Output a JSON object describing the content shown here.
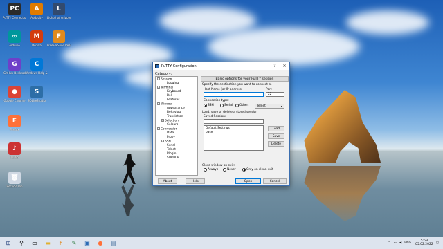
{
  "desktop": {
    "icons": [
      {
        "label": "PuTTY\nConnectio..",
        "color": "#2b2b2b",
        "glyph": "PC"
      },
      {
        "label": "Audacity",
        "color": "#e07b00",
        "glyph": "A"
      },
      {
        "label": "Lightshot\nsnipper",
        "color": "#324a6e",
        "glyph": "L"
      },
      {
        "label": "Arduino",
        "color": "#00979c",
        "glyph": "∞"
      },
      {
        "label": "Mozilla",
        "color": "#d33c0e",
        "glyph": "M"
      },
      {
        "label": "FreeFileSync\nRealtime",
        "color": "#e08a1e",
        "glyph": "F"
      },
      {
        "label": "GitHub\nDesktop",
        "color": "#6e40c9",
        "glyph": "G"
      },
      {
        "label": "Windows\nHelp & Tips",
        "color": "#0078d7",
        "glyph": "C"
      },
      {
        "label": "Google\nChrome",
        "color": "#db4437",
        "glyph": "●"
      },
      {
        "label": "SQLiteStudio",
        "color": "#2d6ea7",
        "glyph": "S"
      },
      {
        "label": "Firefox",
        "color": "#ff7139",
        "glyph": "F"
      },
      {
        "label": "Audio",
        "color": "#cc3333",
        "glyph": "♪"
      },
      {
        "label": "Recycle Bin",
        "color": "#cfd8e3",
        "glyph": "🗑"
      }
    ]
  },
  "putty": {
    "title": "PuTTY Configuration",
    "help_btn": "?",
    "close_btn": "×",
    "category_label": "Category:",
    "tree": [
      {
        "label": "Session",
        "level": 0,
        "exp": "-"
      },
      {
        "label": "Logging",
        "level": 2,
        "exp": ""
      },
      {
        "label": "Terminal",
        "level": 0,
        "exp": "-"
      },
      {
        "label": "Keyboard",
        "level": 2,
        "exp": ""
      },
      {
        "label": "Bell",
        "level": 2,
        "exp": ""
      },
      {
        "label": "Features",
        "level": 2,
        "exp": ""
      },
      {
        "label": "Window",
        "level": 0,
        "exp": "-"
      },
      {
        "label": "Appearance",
        "level": 2,
        "exp": ""
      },
      {
        "label": "Behaviour",
        "level": 2,
        "exp": ""
      },
      {
        "label": "Translation",
        "level": 2,
        "exp": ""
      },
      {
        "label": "Selection",
        "level": 1,
        "exp": "+"
      },
      {
        "label": "Colours",
        "level": 2,
        "exp": ""
      },
      {
        "label": "Connection",
        "level": 0,
        "exp": "-"
      },
      {
        "label": "Data",
        "level": 2,
        "exp": ""
      },
      {
        "label": "Proxy",
        "level": 2,
        "exp": ""
      },
      {
        "label": "SSH",
        "level": 1,
        "exp": "+"
      },
      {
        "label": "Serial",
        "level": 2,
        "exp": ""
      },
      {
        "label": "Telnet",
        "level": 2,
        "exp": ""
      },
      {
        "label": "Rlogin",
        "level": 2,
        "exp": ""
      },
      {
        "label": "SUPDUP",
        "level": 2,
        "exp": ""
      }
    ],
    "panel_header": "Basic options for your PuTTY session",
    "dest_label": "Specify the destination you want to connect to",
    "host_label": "Host Name (or IP address)",
    "host_value": "",
    "port_label": "Port",
    "port_value": "22",
    "conn_type_label": "Connection type:",
    "conn_types": [
      "SSH",
      "Serial",
      "Other:"
    ],
    "conn_selected": "SSH",
    "other_select": "Telnet",
    "sessions_label": "Load, save or delete a stored session",
    "saved_label": "Saved Sessions",
    "saved_value": "",
    "sessions": [
      "Default Settings",
      "base"
    ],
    "btn_load": "Load",
    "btn_save": "Save",
    "btn_delete": "Delete",
    "close_exit_label": "Close window on exit:",
    "exit_options": [
      "Always",
      "Never",
      "Only on clean exit"
    ],
    "exit_selected": "Only on clean exit",
    "btn_about": "About",
    "btn_help": "Help",
    "btn_open": "Open",
    "btn_cancel": "Cancel"
  },
  "taskbar": {
    "icons": [
      "windows-icon",
      "search-icon",
      "task-view-icon",
      "file-explorer-icon",
      "putty-icon",
      "freefilesync-icon",
      "notepad-icon",
      "terminal-icon",
      "firefox-icon",
      "image-icon"
    ],
    "lang": "ENG",
    "time": "5:59",
    "date": "05.02.2022"
  }
}
